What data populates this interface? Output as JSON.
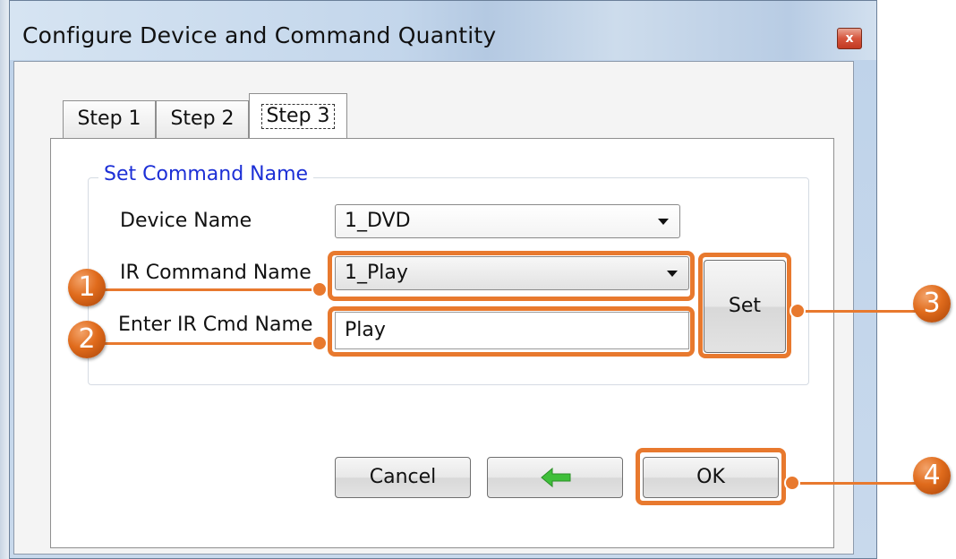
{
  "window": {
    "title": "Configure Device and Command Quantity",
    "close_label": "x"
  },
  "tabs": [
    {
      "label": "Step 1"
    },
    {
      "label": "Step 2"
    },
    {
      "label": "Step 3"
    }
  ],
  "group": {
    "title": "Set Command Name"
  },
  "fields": {
    "device_name_label": "Device Name",
    "device_name_value": "1_DVD",
    "ir_command_label": "IR Command Name",
    "ir_command_value": "1_Play",
    "enter_cmd_label": "Enter IR Cmd Name",
    "enter_cmd_value": "Play"
  },
  "buttons": {
    "set": "Set",
    "cancel": "Cancel",
    "ok": "OK"
  },
  "callouts": [
    "1",
    "2",
    "3",
    "4"
  ],
  "icons": {
    "back": "back-arrow-icon"
  },
  "colors": {
    "highlight": "#e8792e",
    "group_title": "#1c2fd6",
    "back_arrow": "#3fbf3a"
  }
}
